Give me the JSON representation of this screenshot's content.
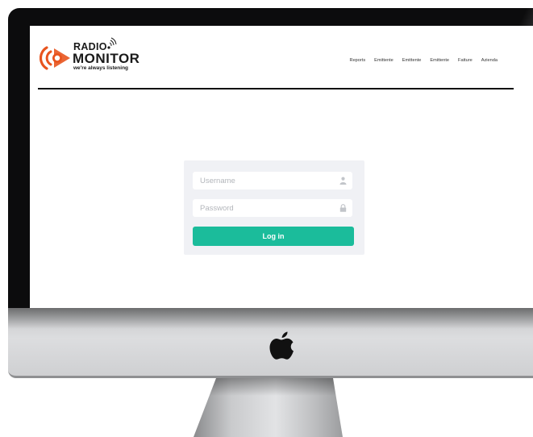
{
  "logo": {
    "line1": "RADIO",
    "line2": "MONITOR",
    "tagline": "we're always listening",
    "brand_color": "#e8541e"
  },
  "nav": {
    "items": [
      {
        "label": "Reports"
      },
      {
        "label": "Emittente"
      },
      {
        "label": "Emittente"
      },
      {
        "label": "Emittente"
      },
      {
        "label": "Fatture"
      },
      {
        "label": "Azienda"
      }
    ]
  },
  "login": {
    "username_placeholder": "Username",
    "password_placeholder": "Password",
    "username_icon": "user-icon",
    "password_icon": "lock-icon",
    "button_label": "Log in",
    "button_color": "#1bbc9b",
    "card_color": "#f0f1f5"
  },
  "device": {
    "logo_icon": "apple-logo-icon"
  }
}
